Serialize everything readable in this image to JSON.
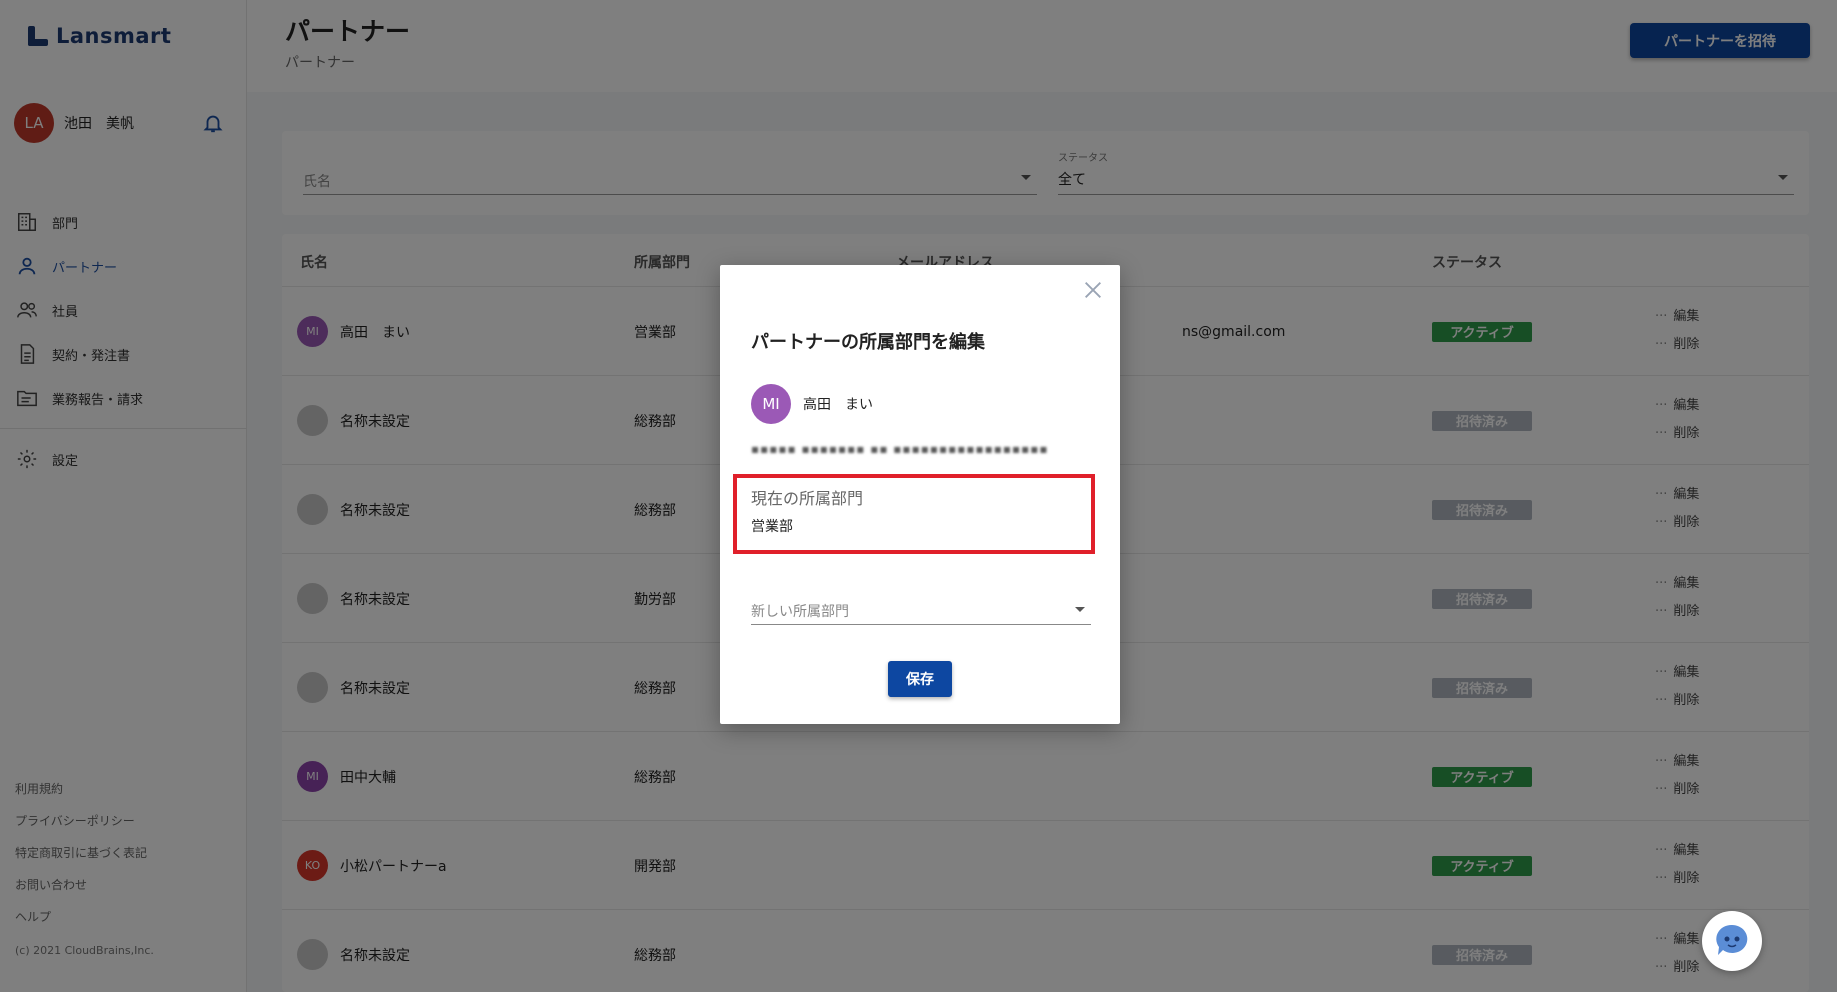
{
  "app": {
    "logo_text": "Lansmart"
  },
  "user": {
    "initials": "LA",
    "name": "池田　美帆",
    "avatar_color": "#c0392b"
  },
  "sidebar": {
    "items": [
      {
        "label": "部門",
        "icon": "building-icon"
      },
      {
        "label": "パートナー",
        "icon": "person-icon",
        "active": true
      },
      {
        "label": "社員",
        "icon": "people-icon"
      },
      {
        "label": "契約・発注書",
        "icon": "document-icon"
      },
      {
        "label": "業務報告・請求",
        "icon": "folder-icon"
      }
    ],
    "settings_label": "設定",
    "footer": [
      "利用規約",
      "プライバシーポリシー",
      "特定商取引に基づく表記",
      "お問い合わせ",
      "ヘルプ"
    ],
    "copyright": "(c) 2021 CloudBrains,Inc."
  },
  "header": {
    "title": "パートナー",
    "breadcrumb": "パートナー",
    "invite_button": "パートナーを招待"
  },
  "filters": {
    "name_placeholder": "氏名",
    "status_label": "ステータス",
    "status_value": "全て"
  },
  "table": {
    "headers": [
      "氏名",
      "所属部門",
      "メールアドレス",
      "ステータス"
    ],
    "rows": [
      {
        "initials": "MI",
        "avatar": "#9b59b6",
        "name": "高田　まい",
        "dept": "営業部",
        "email": "ns@gmail.com",
        "status": "アクティブ",
        "status_color": "#2e9c4a"
      },
      {
        "initials": "",
        "avatar": "#c8c8c8",
        "name": "名称未設定",
        "dept": "総務部",
        "email": "",
        "status": "招待済み",
        "status_color": "#b0b7c0"
      },
      {
        "initials": "",
        "avatar": "#c8c8c8",
        "name": "名称未設定",
        "dept": "総務部",
        "email": "",
        "status": "招待済み",
        "status_color": "#b0b7c0"
      },
      {
        "initials": "",
        "avatar": "#c8c8c8",
        "name": "名称未設定",
        "dept": "勤労部",
        "email": "",
        "status": "招待済み",
        "status_color": "#b0b7c0"
      },
      {
        "initials": "",
        "avatar": "#c8c8c8",
        "name": "名称未設定",
        "dept": "総務部",
        "email": "",
        "status": "招待済み",
        "status_color": "#b0b7c0"
      },
      {
        "initials": "MI",
        "avatar": "#8e44ad",
        "name": "田中大輔",
        "dept": "総務部",
        "email": "",
        "status": "アクティブ",
        "status_color": "#2e9c4a"
      },
      {
        "initials": "KO",
        "avatar": "#d9362b",
        "name": "小松パートナーa",
        "dept": "開発部",
        "email": "",
        "status": "アクティブ",
        "status_color": "#2e9c4a"
      },
      {
        "initials": "",
        "avatar": "#c8c8c8",
        "name": "名称未設定",
        "dept": "総務部",
        "email": "",
        "status": "招待済み",
        "status_color": "#b0b7c0"
      }
    ],
    "edit_label": "編集",
    "delete_label": "削除"
  },
  "dialog": {
    "title": "パートナーの所属部門を編集",
    "user_initials": "MI",
    "user_name": "高田　まい",
    "email_masked": "▪▪▪▪▪ ▪▪▪▪▪▪▪ ▪▪ ▪▪▪▪▪▪▪▪▪▪▪▪▪▪▪▪▪",
    "current_label": "現在の所属部門",
    "current_value": "営業部",
    "new_dept_placeholder": "新しい所属部門",
    "save_button": "保存"
  },
  "colors": {
    "accent": "#0d47a1",
    "highlight": "#e0202a"
  }
}
